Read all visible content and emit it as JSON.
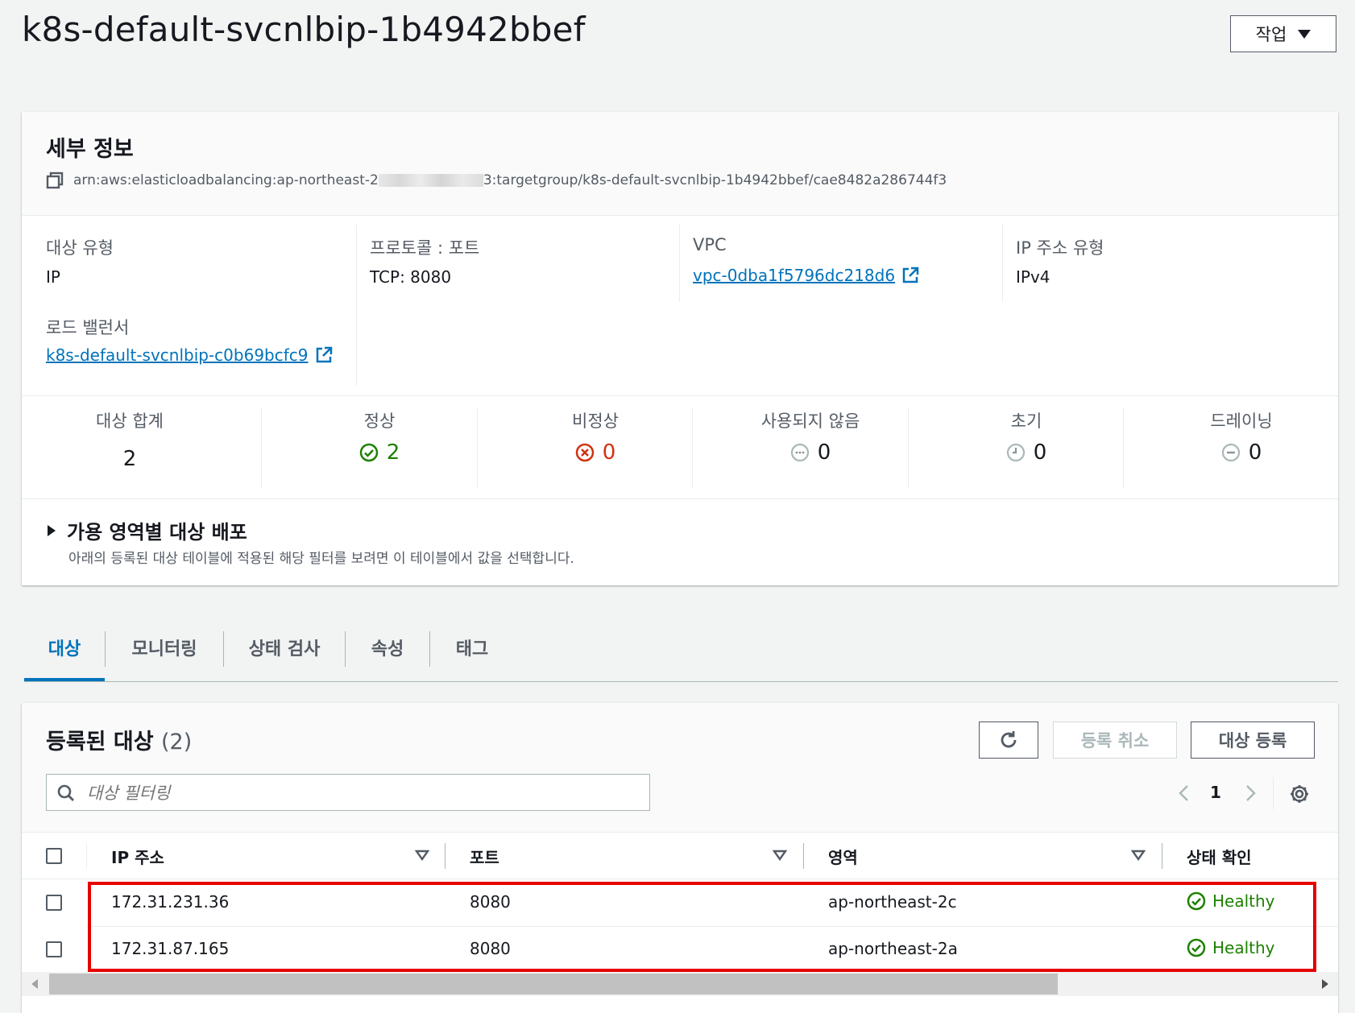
{
  "header": {
    "title": "k8s-default-svcnlbip-1b4942bbef",
    "actions_label": "작업"
  },
  "details": {
    "heading": "세부 정보",
    "arn_prefix": "arn:aws:elasticloadbalancing:ap-northeast-2",
    "arn_suffix": "3:targetgroup/k8s-default-svcnlbip-1b4942bbef/cae8482a286744f3",
    "target_type_label": "대상 유형",
    "target_type_value": "IP",
    "protocol_label": "프로토콜 : 포트",
    "protocol_value": "TCP: 8080",
    "vpc_label": "VPC",
    "vpc_value": "vpc-0dba1f5796dc218d6",
    "ip_type_label": "IP 주소 유형",
    "ip_type_value": "IPv4",
    "lb_label": "로드 밸런서",
    "lb_value": "k8s-default-svcnlbip-c0b69bcfc9"
  },
  "stats": [
    {
      "label": "대상 합계",
      "value": "2"
    },
    {
      "label": "정상",
      "value": "2",
      "color": "#1d8102",
      "icon": "check-circle-icon"
    },
    {
      "label": "비정상",
      "value": "0",
      "color": "#d13212",
      "icon": "x-circle-icon"
    },
    {
      "label": "사용되지 않음",
      "value": "0",
      "color": "#16191f",
      "icon": "dots-circle-icon"
    },
    {
      "label": "초기",
      "value": "0",
      "color": "#16191f",
      "icon": "clock-circle-icon"
    },
    {
      "label": "드레이닝",
      "value": "0",
      "color": "#16191f",
      "icon": "minus-circle-icon"
    }
  ],
  "az_distribution": {
    "title": "가용 영역별 대상 배포",
    "description": "아래의 등록된 대상 테이블에 적용된 해당 필터를 보려면 이 테이블에서 값을 선택합니다."
  },
  "tabs": [
    {
      "label": "대상",
      "active": true
    },
    {
      "label": "모니터링"
    },
    {
      "label": "상태 검사"
    },
    {
      "label": "속성"
    },
    {
      "label": "태그"
    }
  ],
  "targets": {
    "heading": "등록된 대상",
    "count": "(2)",
    "deregister_label": "등록 취소",
    "register_label": "대상 등록",
    "filter_placeholder": "대상 필터링",
    "page": "1",
    "columns": [
      "IP 주소",
      "포트",
      "영역",
      "상태 확인"
    ],
    "rows": [
      {
        "ip": "172.31.231.36",
        "port": "8080",
        "zone": "ap-northeast-2c",
        "health": "Healthy"
      },
      {
        "ip": "172.31.87.165",
        "port": "8080",
        "zone": "ap-northeast-2a",
        "health": "Healthy"
      }
    ],
    "highlight_color": "#e60000"
  }
}
